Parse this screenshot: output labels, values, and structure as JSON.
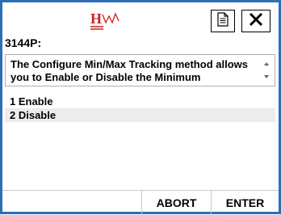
{
  "header": {
    "title": "3144P:",
    "logo_icon": "hw-logo-icon",
    "doc_icon": "document-icon",
    "close_icon": "close-icon"
  },
  "description": "The Configure Min/Max Tracking method allows you to Enable or Disable the Minimum",
  "options": [
    {
      "label": "1 Enable",
      "selected": false
    },
    {
      "label": "2 Disable",
      "selected": true
    }
  ],
  "footer": {
    "abort_label": "ABORT",
    "enter_label": "ENTER"
  },
  "colors": {
    "frame": "#2d6fb5",
    "logo_red": "#d21d1d",
    "selected_row": "#ececec"
  }
}
